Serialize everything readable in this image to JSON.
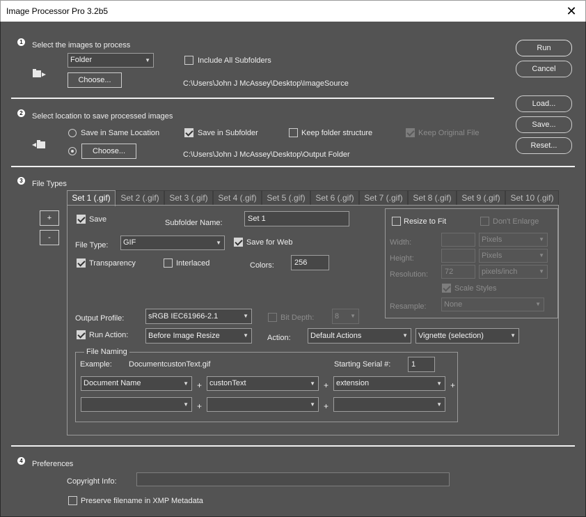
{
  "window": {
    "title": "Image Processor Pro 3.2b5",
    "close_glyph": "✕"
  },
  "section1": {
    "number": "1",
    "title": "Select the images to process",
    "source_select": "Folder",
    "include_subfolders_label": "Include All Subfolders",
    "include_subfolders_checked": false,
    "choose_label": "Choose...",
    "path": "C:\\Users\\John J McAssey\\Desktop\\ImageSource",
    "icon": "folder-open-icon"
  },
  "section2": {
    "number": "2",
    "title": "Select location to save processed images",
    "same_location_label": "Save in Same Location",
    "save_subfolder_label": "Save in Subfolder",
    "keep_structure_label": "Keep folder structure",
    "keep_original_label": "Keep Original File",
    "choose_label": "Choose...",
    "path": "C:\\Users\\John J McAssey\\Desktop\\Output Folder",
    "icon": "folder-save-icon"
  },
  "buttons": {
    "run": "Run",
    "cancel": "Cancel",
    "load": "Load...",
    "save": "Save...",
    "reset": "Reset..."
  },
  "section3": {
    "number": "3",
    "title": "File Types",
    "tabs": [
      "Set 1 (.gif)",
      "Set 2 (.gif)",
      "Set 3 (.gif)",
      "Set 4 (.gif)",
      "Set 5 (.gif)",
      "Set 6 (.gif)",
      "Set 7 (.gif)",
      "Set 8 (.gif)",
      "Set 9 (.gif)",
      "Set 10 (.gif)"
    ],
    "active_tab": 0,
    "add_label": "+",
    "remove_label": "-",
    "save_label": "Save",
    "subfolder_name_label": "Subfolder Name:",
    "subfolder_name_value": "Set 1",
    "file_type_label": "File Type:",
    "file_type_value": "GIF",
    "save_for_web_label": "Save for Web",
    "transparency_label": "Transparency",
    "interlaced_label": "Interlaced",
    "colors_label": "Colors:",
    "colors_value": "256",
    "resize_to_fit_label": "Resize to Fit",
    "dont_enlarge_label": "Don't Enlarge",
    "width_label": "Width:",
    "width_unit": "Pixels",
    "height_label": "Height:",
    "height_unit": "Pixels",
    "resolution_label": "Resolution:",
    "resolution_value": "72",
    "resolution_unit": "pixels/inch",
    "scale_styles_label": "Scale Styles",
    "resample_label": "Resample:",
    "resample_value": "None",
    "output_profile_label": "Output Profile:",
    "output_profile_value": "sRGB IEC61966-2.1",
    "bit_depth_label": "Bit Depth:",
    "bit_depth_value": "8",
    "run_action_label": "Run Action:",
    "run_action_value": "Before Image Resize",
    "action_label": "Action:",
    "action_set_value": "Default Actions",
    "action_value": "Vignette (selection)",
    "file_naming": {
      "legend": "File Naming",
      "example_label": "Example:",
      "example_value": "DocumentcustonText.gif",
      "serial_label": "Starting Serial #:",
      "serial_value": "1",
      "row1": [
        "Document Name",
        "custonText",
        "extension"
      ],
      "row2": [
        "",
        "",
        ""
      ],
      "plus": "+"
    }
  },
  "section4": {
    "number": "4",
    "title": "Preferences",
    "copyright_label": "Copyright Info:",
    "copyright_value": "",
    "preserve_label": "Preserve filename in XMP Metadata"
  },
  "dropdown_glyph": "▼"
}
